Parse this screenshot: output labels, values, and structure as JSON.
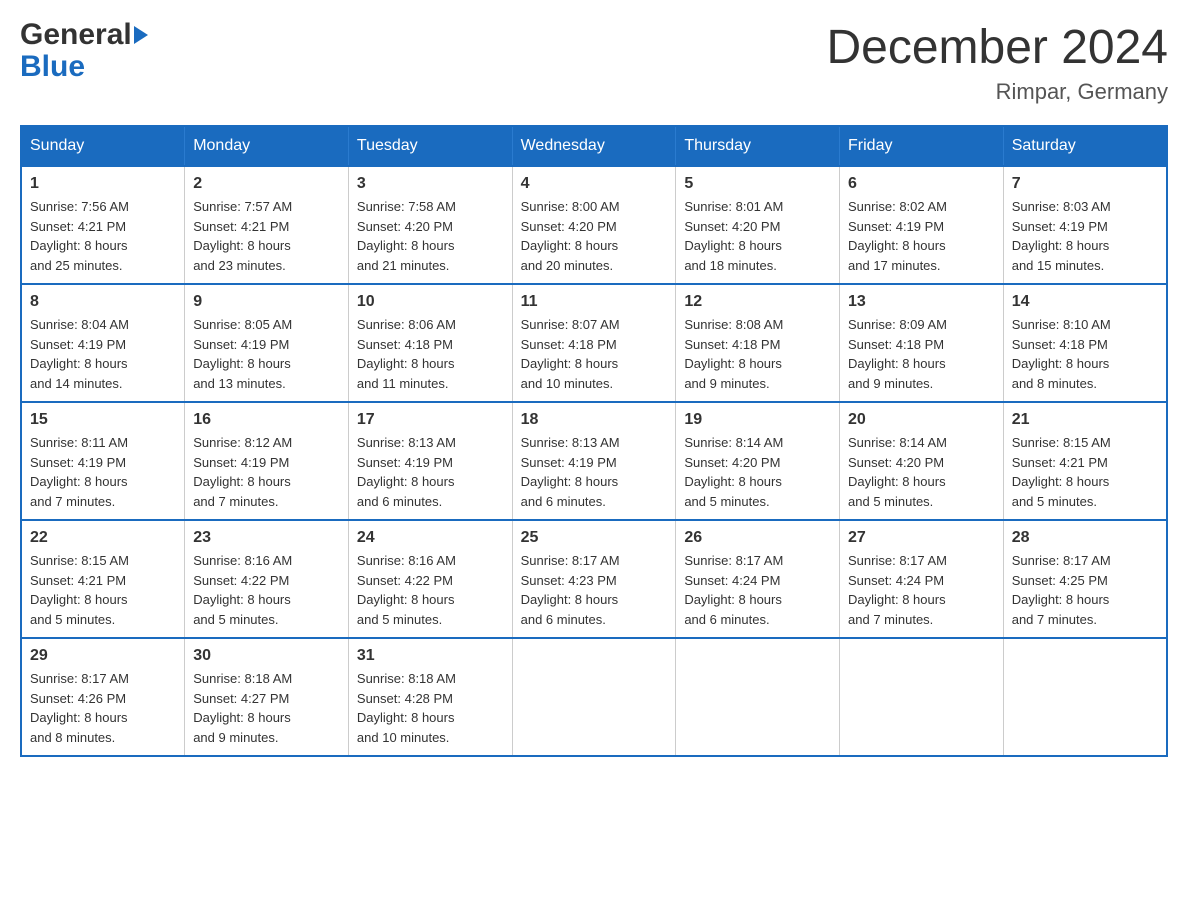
{
  "logo": {
    "line1": "General",
    "line2": "Blue"
  },
  "title": "December 2024",
  "location": "Rimpar, Germany",
  "weekdays": [
    "Sunday",
    "Monday",
    "Tuesday",
    "Wednesday",
    "Thursday",
    "Friday",
    "Saturday"
  ],
  "weeks": [
    [
      {
        "day": "1",
        "sunrise": "Sunrise: 7:56 AM",
        "sunset": "Sunset: 4:21 PM",
        "daylight": "Daylight: 8 hours",
        "daylight2": "and 25 minutes."
      },
      {
        "day": "2",
        "sunrise": "Sunrise: 7:57 AM",
        "sunset": "Sunset: 4:21 PM",
        "daylight": "Daylight: 8 hours",
        "daylight2": "and 23 minutes."
      },
      {
        "day": "3",
        "sunrise": "Sunrise: 7:58 AM",
        "sunset": "Sunset: 4:20 PM",
        "daylight": "Daylight: 8 hours",
        "daylight2": "and 21 minutes."
      },
      {
        "day": "4",
        "sunrise": "Sunrise: 8:00 AM",
        "sunset": "Sunset: 4:20 PM",
        "daylight": "Daylight: 8 hours",
        "daylight2": "and 20 minutes."
      },
      {
        "day": "5",
        "sunrise": "Sunrise: 8:01 AM",
        "sunset": "Sunset: 4:20 PM",
        "daylight": "Daylight: 8 hours",
        "daylight2": "and 18 minutes."
      },
      {
        "day": "6",
        "sunrise": "Sunrise: 8:02 AM",
        "sunset": "Sunset: 4:19 PM",
        "daylight": "Daylight: 8 hours",
        "daylight2": "and 17 minutes."
      },
      {
        "day": "7",
        "sunrise": "Sunrise: 8:03 AM",
        "sunset": "Sunset: 4:19 PM",
        "daylight": "Daylight: 8 hours",
        "daylight2": "and 15 minutes."
      }
    ],
    [
      {
        "day": "8",
        "sunrise": "Sunrise: 8:04 AM",
        "sunset": "Sunset: 4:19 PM",
        "daylight": "Daylight: 8 hours",
        "daylight2": "and 14 minutes."
      },
      {
        "day": "9",
        "sunrise": "Sunrise: 8:05 AM",
        "sunset": "Sunset: 4:19 PM",
        "daylight": "Daylight: 8 hours",
        "daylight2": "and 13 minutes."
      },
      {
        "day": "10",
        "sunrise": "Sunrise: 8:06 AM",
        "sunset": "Sunset: 4:18 PM",
        "daylight": "Daylight: 8 hours",
        "daylight2": "and 11 minutes."
      },
      {
        "day": "11",
        "sunrise": "Sunrise: 8:07 AM",
        "sunset": "Sunset: 4:18 PM",
        "daylight": "Daylight: 8 hours",
        "daylight2": "and 10 minutes."
      },
      {
        "day": "12",
        "sunrise": "Sunrise: 8:08 AM",
        "sunset": "Sunset: 4:18 PM",
        "daylight": "Daylight: 8 hours",
        "daylight2": "and 9 minutes."
      },
      {
        "day": "13",
        "sunrise": "Sunrise: 8:09 AM",
        "sunset": "Sunset: 4:18 PM",
        "daylight": "Daylight: 8 hours",
        "daylight2": "and 9 minutes."
      },
      {
        "day": "14",
        "sunrise": "Sunrise: 8:10 AM",
        "sunset": "Sunset: 4:18 PM",
        "daylight": "Daylight: 8 hours",
        "daylight2": "and 8 minutes."
      }
    ],
    [
      {
        "day": "15",
        "sunrise": "Sunrise: 8:11 AM",
        "sunset": "Sunset: 4:19 PM",
        "daylight": "Daylight: 8 hours",
        "daylight2": "and 7 minutes."
      },
      {
        "day": "16",
        "sunrise": "Sunrise: 8:12 AM",
        "sunset": "Sunset: 4:19 PM",
        "daylight": "Daylight: 8 hours",
        "daylight2": "and 7 minutes."
      },
      {
        "day": "17",
        "sunrise": "Sunrise: 8:13 AM",
        "sunset": "Sunset: 4:19 PM",
        "daylight": "Daylight: 8 hours",
        "daylight2": "and 6 minutes."
      },
      {
        "day": "18",
        "sunrise": "Sunrise: 8:13 AM",
        "sunset": "Sunset: 4:19 PM",
        "daylight": "Daylight: 8 hours",
        "daylight2": "and 6 minutes."
      },
      {
        "day": "19",
        "sunrise": "Sunrise: 8:14 AM",
        "sunset": "Sunset: 4:20 PM",
        "daylight": "Daylight: 8 hours",
        "daylight2": "and 5 minutes."
      },
      {
        "day": "20",
        "sunrise": "Sunrise: 8:14 AM",
        "sunset": "Sunset: 4:20 PM",
        "daylight": "Daylight: 8 hours",
        "daylight2": "and 5 minutes."
      },
      {
        "day": "21",
        "sunrise": "Sunrise: 8:15 AM",
        "sunset": "Sunset: 4:21 PM",
        "daylight": "Daylight: 8 hours",
        "daylight2": "and 5 minutes."
      }
    ],
    [
      {
        "day": "22",
        "sunrise": "Sunrise: 8:15 AM",
        "sunset": "Sunset: 4:21 PM",
        "daylight": "Daylight: 8 hours",
        "daylight2": "and 5 minutes."
      },
      {
        "day": "23",
        "sunrise": "Sunrise: 8:16 AM",
        "sunset": "Sunset: 4:22 PM",
        "daylight": "Daylight: 8 hours",
        "daylight2": "and 5 minutes."
      },
      {
        "day": "24",
        "sunrise": "Sunrise: 8:16 AM",
        "sunset": "Sunset: 4:22 PM",
        "daylight": "Daylight: 8 hours",
        "daylight2": "and 5 minutes."
      },
      {
        "day": "25",
        "sunrise": "Sunrise: 8:17 AM",
        "sunset": "Sunset: 4:23 PM",
        "daylight": "Daylight: 8 hours",
        "daylight2": "and 6 minutes."
      },
      {
        "day": "26",
        "sunrise": "Sunrise: 8:17 AM",
        "sunset": "Sunset: 4:24 PM",
        "daylight": "Daylight: 8 hours",
        "daylight2": "and 6 minutes."
      },
      {
        "day": "27",
        "sunrise": "Sunrise: 8:17 AM",
        "sunset": "Sunset: 4:24 PM",
        "daylight": "Daylight: 8 hours",
        "daylight2": "and 7 minutes."
      },
      {
        "day": "28",
        "sunrise": "Sunrise: 8:17 AM",
        "sunset": "Sunset: 4:25 PM",
        "daylight": "Daylight: 8 hours",
        "daylight2": "and 7 minutes."
      }
    ],
    [
      {
        "day": "29",
        "sunrise": "Sunrise: 8:17 AM",
        "sunset": "Sunset: 4:26 PM",
        "daylight": "Daylight: 8 hours",
        "daylight2": "and 8 minutes."
      },
      {
        "day": "30",
        "sunrise": "Sunrise: 8:18 AM",
        "sunset": "Sunset: 4:27 PM",
        "daylight": "Daylight: 8 hours",
        "daylight2": "and 9 minutes."
      },
      {
        "day": "31",
        "sunrise": "Sunrise: 8:18 AM",
        "sunset": "Sunset: 4:28 PM",
        "daylight": "Daylight: 8 hours",
        "daylight2": "and 10 minutes."
      },
      {
        "day": "",
        "sunrise": "",
        "sunset": "",
        "daylight": "",
        "daylight2": ""
      },
      {
        "day": "",
        "sunrise": "",
        "sunset": "",
        "daylight": "",
        "daylight2": ""
      },
      {
        "day": "",
        "sunrise": "",
        "sunset": "",
        "daylight": "",
        "daylight2": ""
      },
      {
        "day": "",
        "sunrise": "",
        "sunset": "",
        "daylight": "",
        "daylight2": ""
      }
    ]
  ]
}
